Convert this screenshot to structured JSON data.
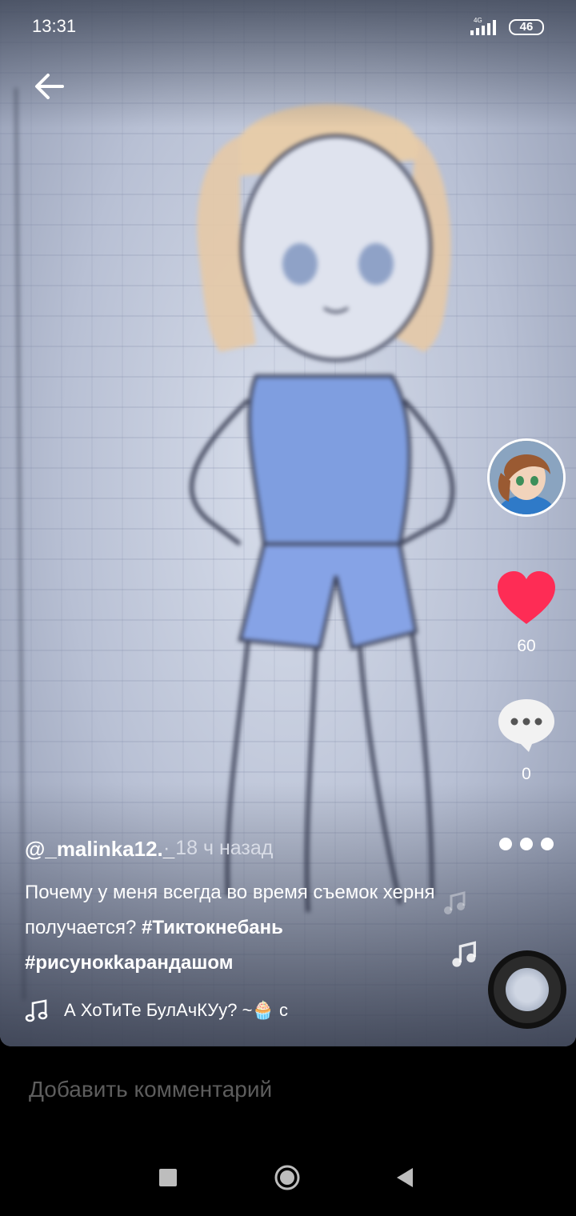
{
  "status": {
    "time": "13:31",
    "network": "4G",
    "battery": "46"
  },
  "video": {
    "likes": "60",
    "comments": "0",
    "author": "@_malinka12._",
    "time_ago": "· 18 ч назад",
    "caption_text": "Почему у меня всегда во время съемок херня получается? ",
    "hashtags": [
      "#Тиктокнебань",
      "#рисунокkарандашом"
    ],
    "music": "А ХоТиТе БулАчКУу? ~🧁  с"
  },
  "comment_bar": {
    "placeholder": "Добавить комментарий"
  },
  "icons": {
    "back": "back-arrow-icon",
    "like": "heart-icon",
    "comment": "comment-bubble-icon",
    "more": "more-dots-icon",
    "music": "music-note-icon"
  },
  "colors": {
    "like": "#fe2c55",
    "comment_placeholder": "#5d5d5d"
  }
}
